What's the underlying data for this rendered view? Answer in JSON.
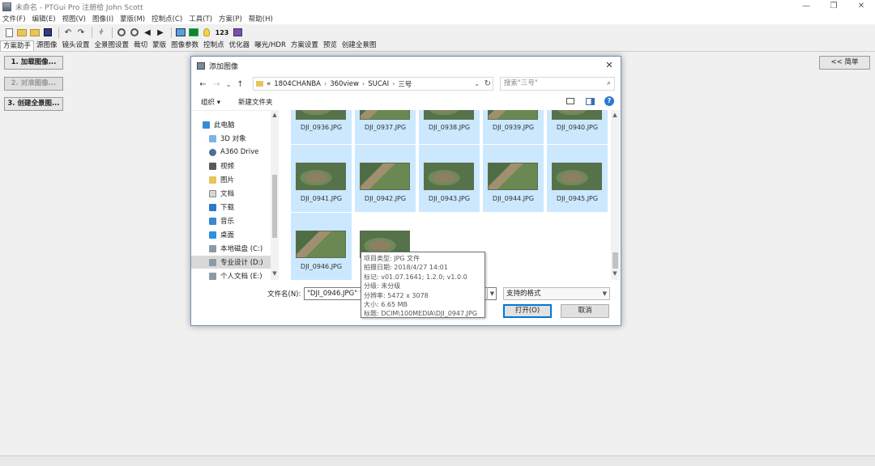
{
  "window": {
    "title": "未命名 - PTGui Pro 注册给 John Scott",
    "controls": [
      "—",
      "❐",
      "✕"
    ]
  },
  "menu": [
    "文件(F)",
    "编辑(E)",
    "视图(V)",
    "图像(I)",
    "蒙版(M)",
    "控制点(C)",
    "工具(T)",
    "方案(P)",
    "帮助(H)"
  ],
  "toolbar": {
    "counter_label": "123"
  },
  "tabs": [
    "方案助手",
    "源图像",
    "镜头设置",
    "全景图设置",
    "裁切",
    "蒙版",
    "图像参数",
    "控制点",
    "优化器",
    "曝光/HDR",
    "方案设置",
    "预览",
    "创建全景图"
  ],
  "side_buttons": [
    "1. 加载图像...",
    "2. 对准图像...",
    "3. 创建全景图..."
  ],
  "simple_button": "<< 简单",
  "dialog": {
    "title": "添加图像",
    "close": "✕",
    "nav": {
      "back": "←",
      "forward": "→",
      "recent": "⌄",
      "up": "↑"
    },
    "breadcrumb": [
      "«",
      "1804CHANBA",
      "›",
      "360view",
      "›",
      "SUCAI",
      "›",
      "三号"
    ],
    "search_placeholder": "搜索\"三号\"",
    "commands": [
      "组织 ▾",
      "新建文件夹"
    ],
    "nav_items": [
      "此电脑",
      "3D 对象",
      "A360 Drive",
      "视频",
      "图片",
      "文档",
      "下载",
      "音乐",
      "桌面",
      "本地磁盘 (C:)",
      "专业设计 (D:)",
      "个人文档 (E:)"
    ],
    "files": [
      "DJI_0936.JPG",
      "DJI_0937.JPG",
      "DJI_0938.JPG",
      "DJI_0939.JPG",
      "DJI_0940.JPG",
      "DJI_0941.JPG",
      "DJI_0942.JPG",
      "DJI_0943.JPG",
      "DJI_0944.JPG",
      "DJI_0945.JPG",
      "DJI_0946.JPG"
    ],
    "filename_label": "文件名(N):",
    "filename_value": "\"DJI_0946.JPG\" \"",
    "filetype": "支持的格式",
    "open": "打开(O)",
    "cancel": "取消"
  },
  "tooltip": [
    "项目类型: JPG 文件",
    "拍摄日期: 2018/4/27 14:01",
    "标记: v01.07.1641; 1.2.0; v1.0.0",
    "分级: 未分级",
    "分辨率: 5472 x 3078",
    "大小: 6.65 MB",
    "标题: DCIM\\100MEDIA\\DJI_0947.JPG"
  ]
}
